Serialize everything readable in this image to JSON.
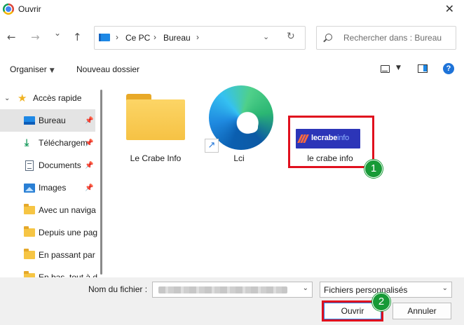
{
  "window": {
    "title": "Ouvrir",
    "close_glyph": "✕"
  },
  "nav_buttons": {
    "back": "←",
    "forward": "→",
    "recent": "⌄",
    "up": "↑"
  },
  "address": {
    "crumbs": [
      "Ce PC",
      "Bureau"
    ],
    "separator": "›",
    "dropdown": "⌄",
    "refresh": "↻"
  },
  "search": {
    "placeholder": "Rechercher dans : Bureau"
  },
  "toolbar": {
    "organize": "Organiser",
    "new_folder": "Nouveau dossier",
    "help": "?"
  },
  "sidebar": {
    "quick_access": "Accès rapide",
    "items": [
      {
        "label": "Bureau",
        "icon": "desktop-icon",
        "pinned": true,
        "selected": true
      },
      {
        "label": "Téléchargem",
        "icon": "download-icon",
        "pinned": true
      },
      {
        "label": "Documents",
        "icon": "document-icon",
        "pinned": true
      },
      {
        "label": "Images",
        "icon": "image-icon",
        "pinned": true
      },
      {
        "label": "Avec un naviga",
        "icon": "folder-icon"
      },
      {
        "label": "Depuis une pag",
        "icon": "folder-icon"
      },
      {
        "label": "En passant par",
        "icon": "folder-icon"
      },
      {
        "label": "En bas, tout à d",
        "icon": "folder-icon"
      }
    ]
  },
  "files": [
    {
      "label": "Le Crabe Info",
      "type": "folder"
    },
    {
      "label": "Lci",
      "type": "edge-shortcut"
    },
    {
      "label": "le crabe info",
      "type": "image",
      "thumb_text": {
        "part1": "lecrabe",
        "part2": "info"
      }
    }
  ],
  "markers": [
    "1",
    "2"
  ],
  "footer": {
    "filename_label": "Nom du fichier :",
    "filetype": "Fichiers personnalisés",
    "open": "Ouvrir",
    "cancel": "Annuler"
  },
  "colors": {
    "highlight": "#e0101e",
    "marker": "#179a36",
    "accent": "#1e73d8"
  }
}
